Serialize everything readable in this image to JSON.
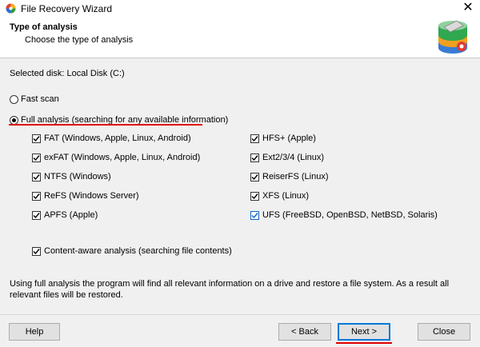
{
  "window": {
    "title": "File Recovery Wizard",
    "close_glyph": "✕"
  },
  "header": {
    "title": "Type of analysis",
    "subtitle": "Choose the type of analysis"
  },
  "selected_disk": "Selected disk: Local Disk (C:)",
  "scan_options": {
    "fast_scan": {
      "label": "Fast scan",
      "selected": false
    },
    "full_analysis": {
      "label": "Full analysis (searching for any available information)",
      "selected": true
    }
  },
  "filesystems_left": [
    {
      "label": "FAT (Windows, Apple, Linux, Android)",
      "checked": true
    },
    {
      "label": "exFAT (Windows, Apple, Linux, Android)",
      "checked": true
    },
    {
      "label": "NTFS (Windows)",
      "checked": true
    },
    {
      "label": "ReFS (Windows Server)",
      "checked": true
    },
    {
      "label": "APFS (Apple)",
      "checked": true
    }
  ],
  "filesystems_right": [
    {
      "label": "HFS+ (Apple)",
      "checked": true
    },
    {
      "label": "Ext2/3/4 (Linux)",
      "checked": true
    },
    {
      "label": "ReiserFS (Linux)",
      "checked": true
    },
    {
      "label": "XFS (Linux)",
      "checked": true
    },
    {
      "label": "UFS (FreeBSD, OpenBSD, NetBSD, Solaris)",
      "checked": true
    }
  ],
  "content_aware": {
    "label": "Content-aware analysis (searching file contents)",
    "checked": true
  },
  "info_text": "Using full analysis the program will find all relevant information on a drive and restore a file system. As a result all relevant files will be restored.",
  "buttons": {
    "help": "Help",
    "back": "< Back",
    "next": "Next >",
    "close": "Close"
  },
  "icons": {
    "app": "file-recovery-app-icon",
    "header_logo": "disk-recovery-logo-icon",
    "close": "close-icon",
    "check": "checkmark-icon"
  },
  "colors": {
    "annotation_red": "#e00000",
    "primary_border": "#0078d7",
    "panel_bg": "#f0f0f0"
  }
}
